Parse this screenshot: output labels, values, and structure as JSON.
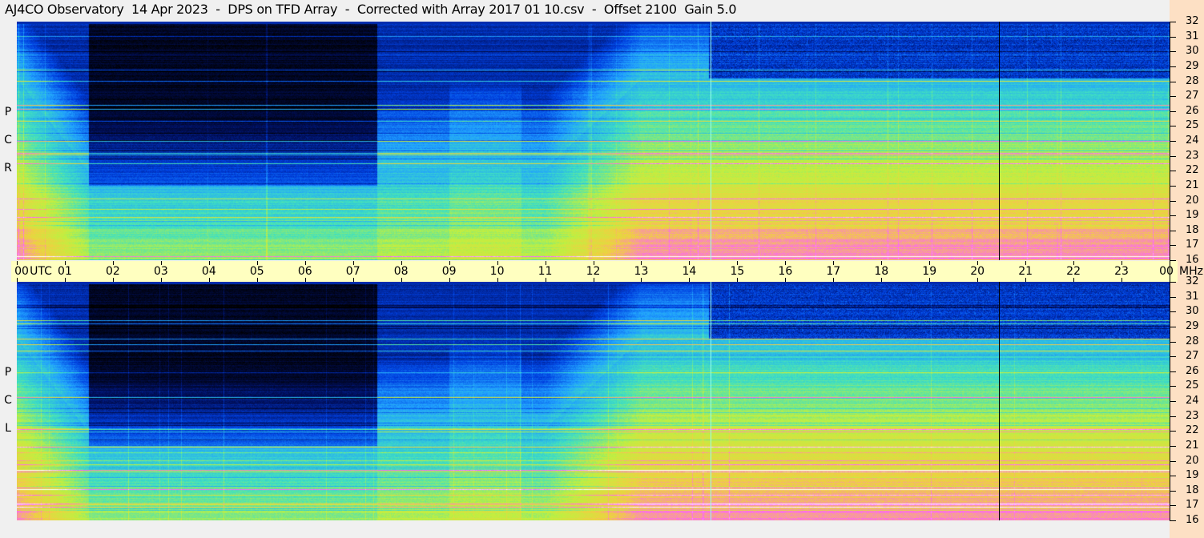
{
  "title": "AJ4CO Observatory  14 Apr 2023  -  DPS on TFD Array  -  Corrected with Array 2017 01 10.csv  -  Offset 2100  Gain 5.0",
  "chart_data": {
    "type": "heatmap",
    "title": "AJ4CO Observatory  14 Apr 2023  -  DPS on TFD Array  -  Corrected with Array 2017 01 10.csv  -  Offset 2100  Gain 5.0",
    "xlabel": "UTC",
    "ylabel": "MHz",
    "xlim": [
      0,
      24
    ],
    "ylim": [
      16,
      32
    ],
    "x_ticks": [
      "00",
      "01",
      "02",
      "03",
      "04",
      "05",
      "06",
      "07",
      "08",
      "09",
      "10",
      "11",
      "12",
      "13",
      "14",
      "15",
      "16",
      "17",
      "18",
      "19",
      "20",
      "21",
      "22",
      "23",
      "00"
    ],
    "y_ticks": [
      "32",
      "31",
      "30",
      "29",
      "28",
      "27",
      "26",
      "25",
      "24",
      "23",
      "22",
      "21",
      "20",
      "19",
      "18",
      "17",
      "16"
    ],
    "panels": [
      {
        "name": "RCP",
        "label": [
          "P",
          "C",
          "R"
        ]
      },
      {
        "name": "LCP",
        "label": [
          "P",
          "C",
          "L"
        ]
      }
    ],
    "markers_utc": [
      14.45,
      20.45
    ],
    "colormap": [
      "#000000",
      "#001060",
      "#0040e0",
      "#20a0ff",
      "#40e0c0",
      "#c0f040",
      "#f0d040",
      "#ff60ff",
      "#ffffff"
    ]
  }
}
